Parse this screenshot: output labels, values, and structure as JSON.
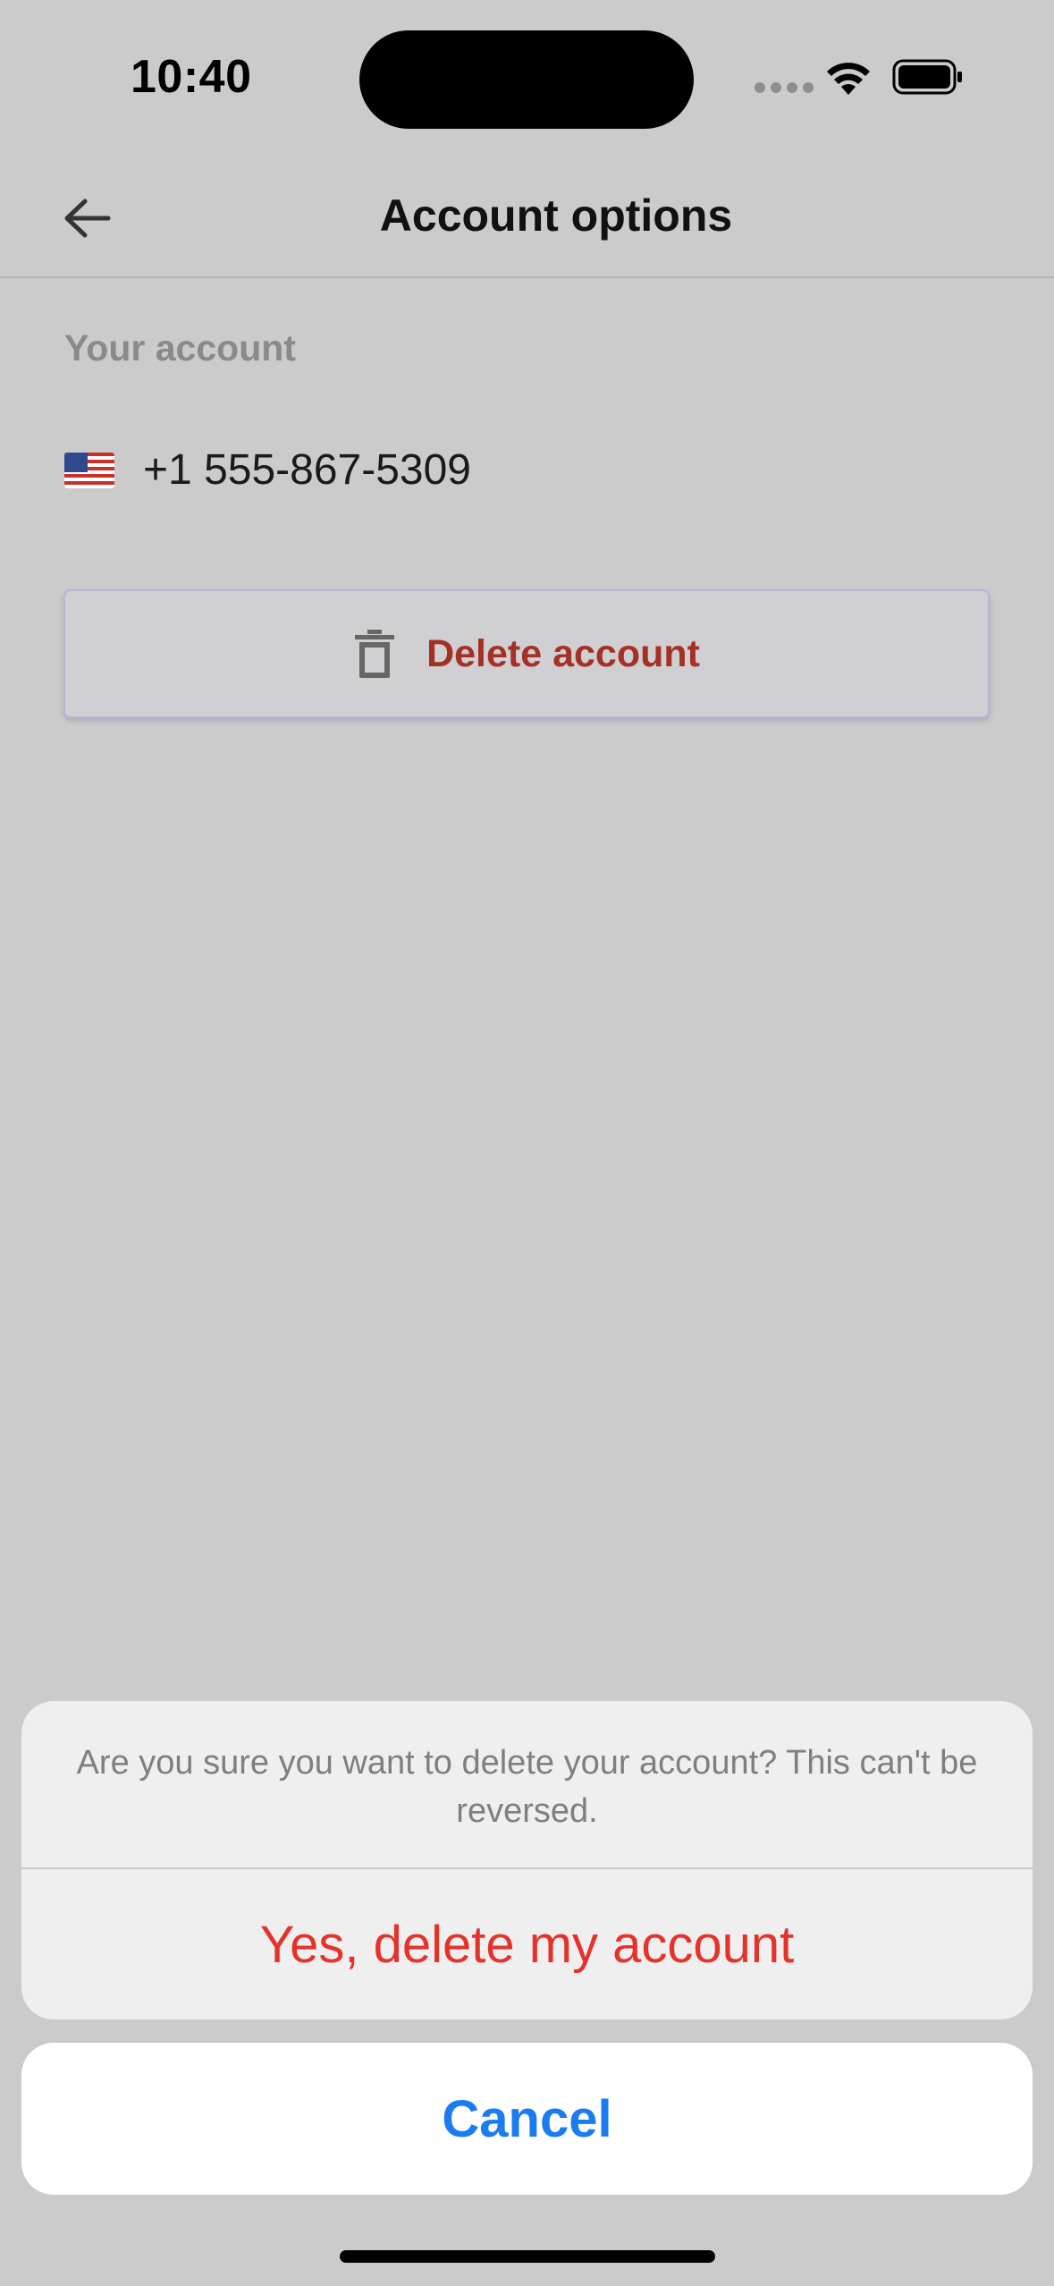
{
  "status_bar": {
    "time": "10:40"
  },
  "nav": {
    "title": "Account options",
    "back_icon": "arrow-left-icon"
  },
  "account": {
    "section_label": "Your account",
    "flag_icon": "us-flag-icon",
    "phone_number": "+1 555-867-5309"
  },
  "delete_button": {
    "icon": "trash-icon",
    "label": "Delete account"
  },
  "action_sheet": {
    "message": "Are you sure you want to delete your account? This can't be reversed.",
    "destructive_label": "Yes, delete my account",
    "cancel_label": "Cancel"
  },
  "colors": {
    "background": "#cbcbcb",
    "destructive": "#e5322b",
    "delete_text": "#a53026",
    "cancel_blue": "#1a7cf0"
  }
}
